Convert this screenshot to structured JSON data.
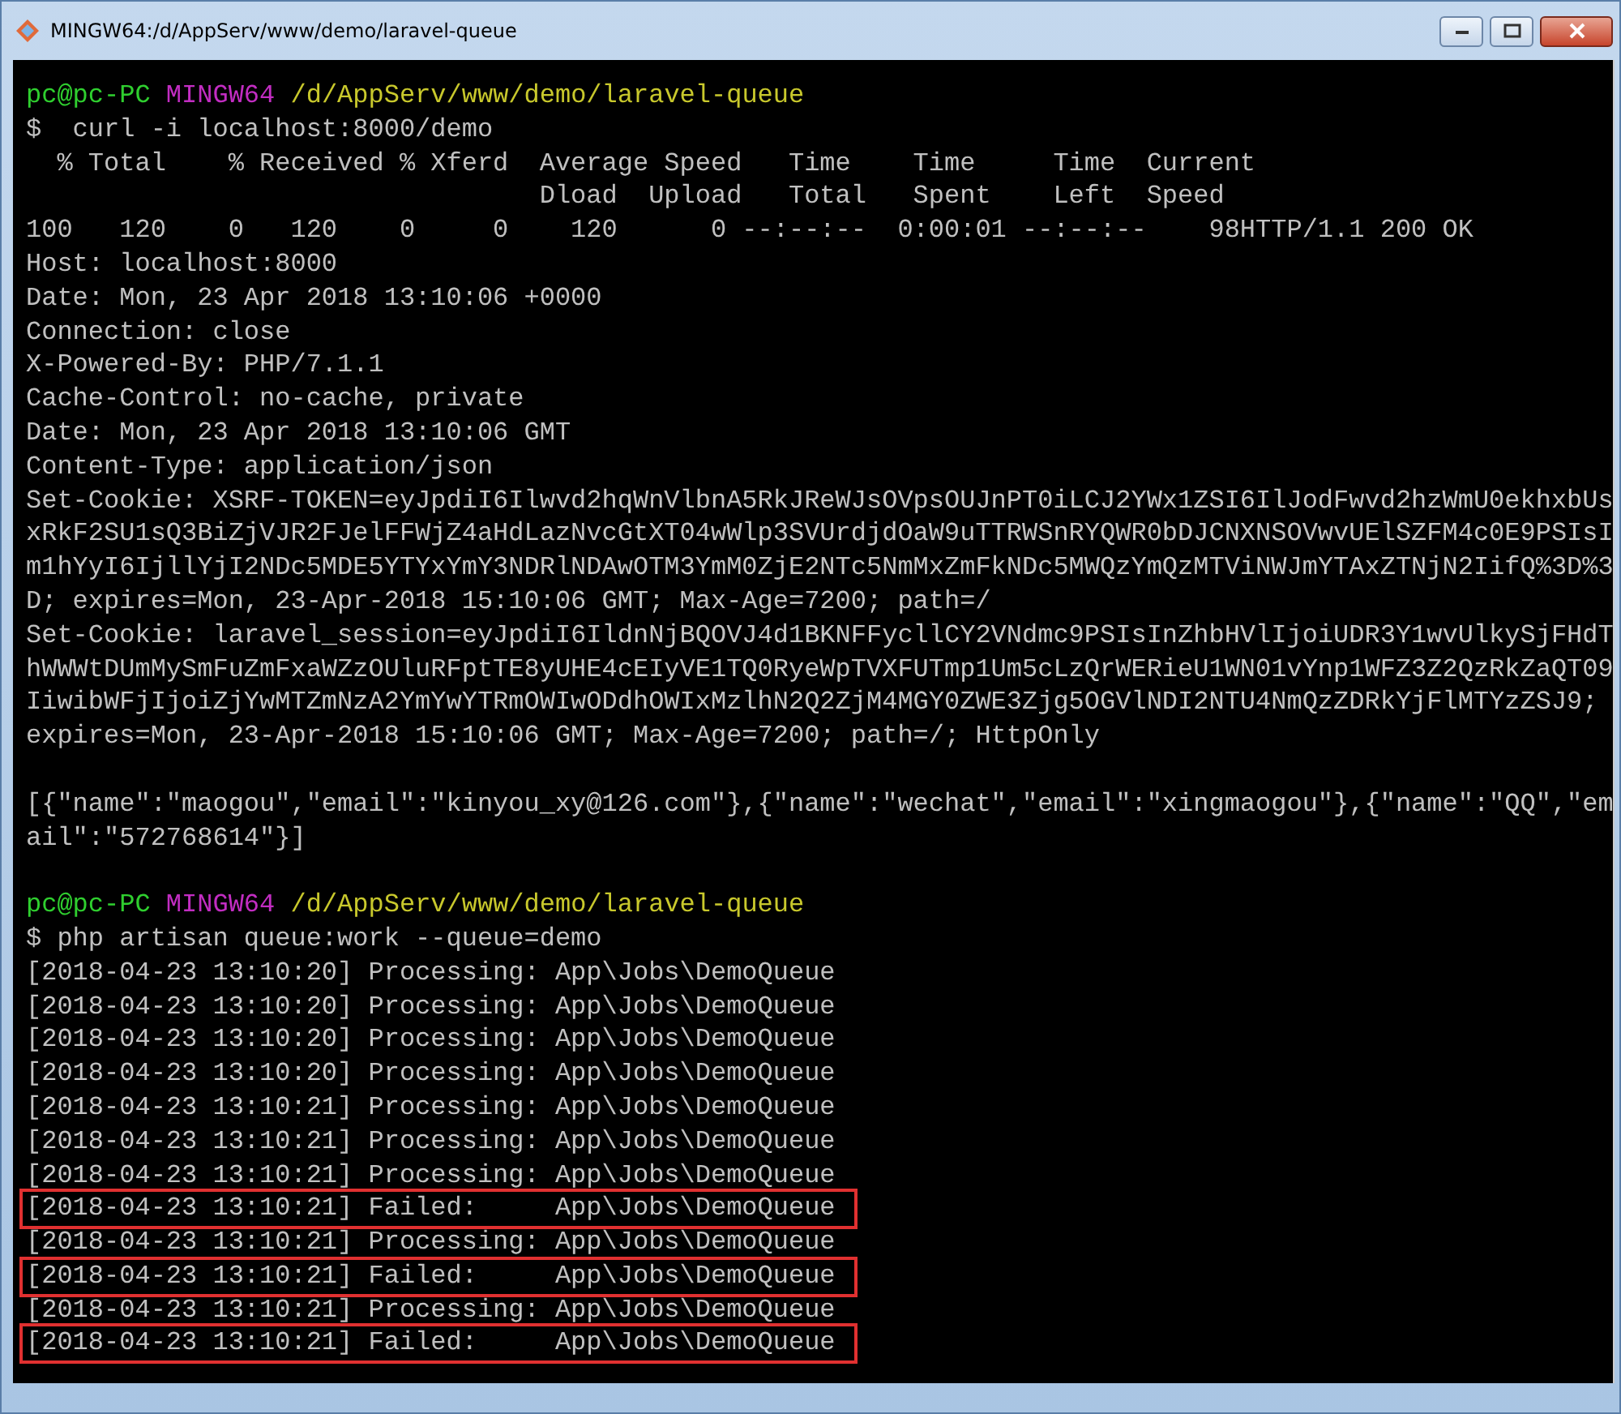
{
  "window": {
    "title": "MINGW64:/d/AppServ/www/demo/laravel-queue"
  },
  "terminal": {
    "lines": [
      {
        "kind": "prompt",
        "user": "pc@pc-PC",
        "shell": "MINGW64",
        "path": "/d/AppServ/www/demo/laravel-queue"
      },
      {
        "kind": "text",
        "text": "$  curl -i localhost:8000/demo",
        "highlighted": false
      },
      {
        "kind": "text",
        "text": "  % Total    % Received % Xferd  Average Speed   Time    Time     Time  Current",
        "highlighted": false
      },
      {
        "kind": "text",
        "text": "                                 Dload  Upload   Total   Spent    Left  Speed",
        "highlighted": false
      },
      {
        "kind": "text",
        "text": "100   120    0   120    0     0    120      0 --:--:--  0:00:01 --:--:--    98HTTP/1.1 200 OK",
        "highlighted": false
      },
      {
        "kind": "text",
        "text": "Host: localhost:8000",
        "highlighted": false
      },
      {
        "kind": "text",
        "text": "Date: Mon, 23 Apr 2018 13:10:06 +0000",
        "highlighted": false
      },
      {
        "kind": "text",
        "text": "Connection: close",
        "highlighted": false
      },
      {
        "kind": "text",
        "text": "X-Powered-By: PHP/7.1.1",
        "highlighted": false
      },
      {
        "kind": "text",
        "text": "Cache-Control: no-cache, private",
        "highlighted": false
      },
      {
        "kind": "text",
        "text": "Date: Mon, 23 Apr 2018 13:10:06 GMT",
        "highlighted": false
      },
      {
        "kind": "text",
        "text": "Content-Type: application/json",
        "highlighted": false
      },
      {
        "kind": "text",
        "text": "Set-Cookie: XSRF-TOKEN=eyJpdiI6Ilwvd2hqWnVlbnA5RkJReWJsOVpsOUJnPT0iLCJ2YWx1ZSI6IlJodFwvd2hzWmU0ekhxbUs",
        "highlighted": false
      },
      {
        "kind": "text",
        "text": "xRkF2SU1sQ3BiZjVJR2FJelFFWjZ4aHdLazNvcGtXT04wWlp3SVUrdjdOaW9uTTRWSnRYQWR0bDJCNXNSOVwvUElSZFM4c0E9PSIsI",
        "highlighted": false
      },
      {
        "kind": "text",
        "text": "m1hYyI6IjllYjI2NDc5MDE5YTYxYmY3NDRlNDAwOTM3YmM0ZjE2NTc5NmMxZmFkNDc5MWQzYmQzMTViNWJmYTAxZTNjN2IifQ%3D%3",
        "highlighted": false
      },
      {
        "kind": "text",
        "text": "D; expires=Mon, 23-Apr-2018 15:10:06 GMT; Max-Age=7200; path=/",
        "highlighted": false
      },
      {
        "kind": "text",
        "text": "Set-Cookie: laravel_session=eyJpdiI6IldnNjBQOVJ4d1BKNFFycllCY2VNdmc9PSIsInZhbHVlIjoiUDR3Y1wvUlkySjFHdT",
        "highlighted": false
      },
      {
        "kind": "text",
        "text": "hWWWtDUmMySmFuZmFxaWZzOUluRFptTE8yUHE4cEIyVE1TQ0RyeWpTVXFUTmp1Um5cLzQrWERieU1WN01vYnp1WFZ3Z2QzRkZaQT09",
        "highlighted": false
      },
      {
        "kind": "text",
        "text": "IiwibWFjIjoiZjYwMTZmNzA2YmYwYTRmOWIwODdhOWIxMzlhN2Q2ZjM4MGY0ZWE3Zjg5OGVlNDI2NTU4NmQzZDRkYjFlMTYzZSJ9;",
        "highlighted": false
      },
      {
        "kind": "text",
        "text": "expires=Mon, 23-Apr-2018 15:10:06 GMT; Max-Age=7200; path=/; HttpOnly",
        "highlighted": false
      },
      {
        "kind": "blank"
      },
      {
        "kind": "text",
        "text": "[{\"name\":\"maogou\",\"email\":\"kinyou_xy@126.com\"},{\"name\":\"wechat\",\"email\":\"xingmaogou\"},{\"name\":\"QQ\",\"em",
        "highlighted": false
      },
      {
        "kind": "text",
        "text": "ail\":\"572768614\"}]",
        "highlighted": false
      },
      {
        "kind": "blank"
      },
      {
        "kind": "prompt",
        "user": "pc@pc-PC",
        "shell": "MINGW64",
        "path": "/d/AppServ/www/demo/laravel-queue"
      },
      {
        "kind": "text",
        "text": "$ php artisan queue:work --queue=demo",
        "highlighted": false
      },
      {
        "kind": "text",
        "text": "[2018-04-23 13:10:20] Processing: App\\Jobs\\DemoQueue",
        "highlighted": false
      },
      {
        "kind": "text",
        "text": "[2018-04-23 13:10:20] Processing: App\\Jobs\\DemoQueue",
        "highlighted": false
      },
      {
        "kind": "text",
        "text": "[2018-04-23 13:10:20] Processing: App\\Jobs\\DemoQueue",
        "highlighted": false
      },
      {
        "kind": "text",
        "text": "[2018-04-23 13:10:20] Processing: App\\Jobs\\DemoQueue",
        "highlighted": false
      },
      {
        "kind": "text",
        "text": "[2018-04-23 13:10:21] Processing: App\\Jobs\\DemoQueue",
        "highlighted": false
      },
      {
        "kind": "text",
        "text": "[2018-04-23 13:10:21] Processing: App\\Jobs\\DemoQueue",
        "highlighted": false
      },
      {
        "kind": "text",
        "text": "[2018-04-23 13:10:21] Processing: App\\Jobs\\DemoQueue",
        "highlighted": false
      },
      {
        "kind": "text",
        "text": "[2018-04-23 13:10:21] Failed:     App\\Jobs\\DemoQueue",
        "highlighted": true
      },
      {
        "kind": "text",
        "text": "[2018-04-23 13:10:21] Processing: App\\Jobs\\DemoQueue",
        "highlighted": false
      },
      {
        "kind": "text",
        "text": "[2018-04-23 13:10:21] Failed:     App\\Jobs\\DemoQueue",
        "highlighted": true
      },
      {
        "kind": "text",
        "text": "[2018-04-23 13:10:21] Processing: App\\Jobs\\DemoQueue",
        "highlighted": false
      },
      {
        "kind": "text",
        "text": "[2018-04-23 13:10:21] Failed:     App\\Jobs\\DemoQueue",
        "highlighted": true
      }
    ]
  }
}
